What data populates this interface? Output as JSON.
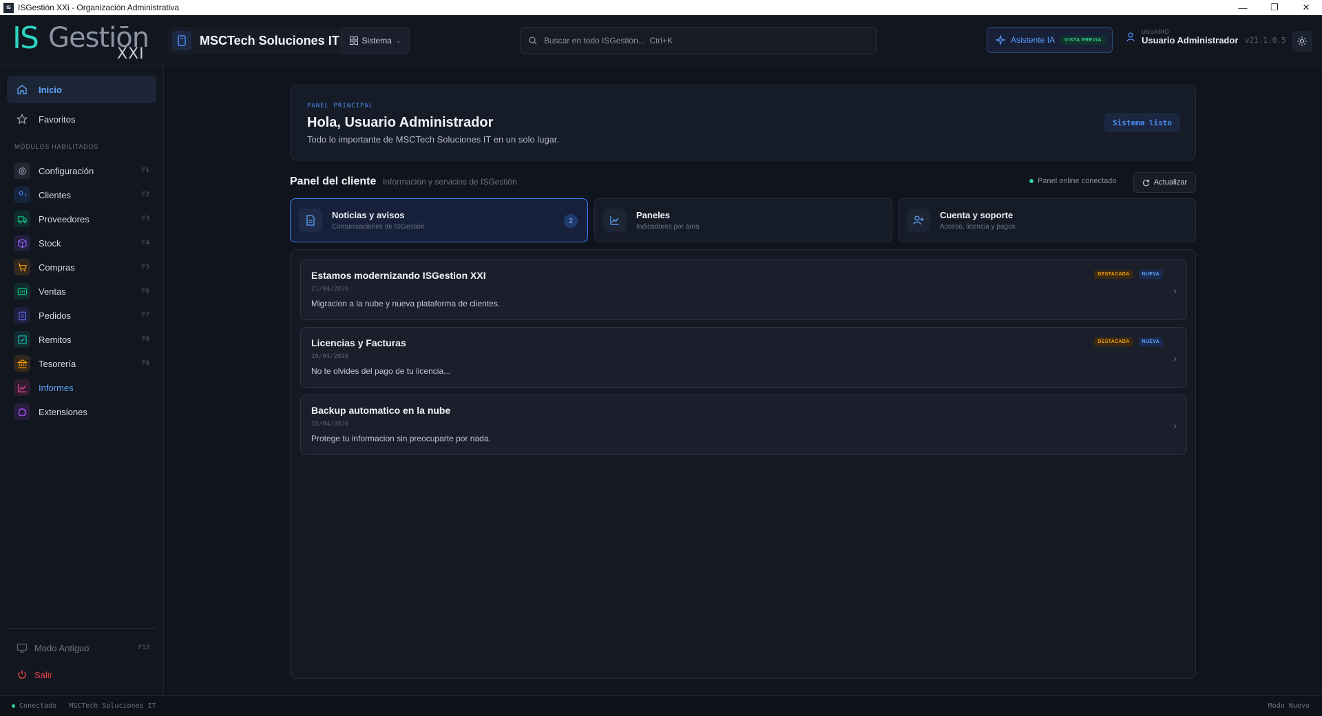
{
  "window": {
    "icon_text": "IS",
    "title": "ISGestión XXi - Organización Administrativa",
    "buttons": [
      "—",
      "❐",
      "✕"
    ]
  },
  "header": {
    "logo": {
      "is": "IS",
      "gestion": "Gestiōn",
      "xxi": "XXI"
    },
    "company_name": "MSCTech Soluciones IT",
    "system_button": "Sistema",
    "search_placeholder": "Buscar en todo ISGestión...  Ctrl+K",
    "ai_label": "Asistente IA",
    "ai_badge": "VISTA PREVIA",
    "user_caption": "USUARIO",
    "user_name": "Usuario Administrador",
    "version": "v21.1.0.5"
  },
  "sidebar": {
    "top_items": [
      {
        "label": "Inicio",
        "icon": "home-icon"
      },
      {
        "label": "Favoritos",
        "icon": "star-icon"
      }
    ],
    "section_title": "MÓDULOS HABILITADOS",
    "modules": [
      {
        "label": "Configuración",
        "key": "F1",
        "icon": "settings-icon",
        "color": "#8b93a3"
      },
      {
        "label": "Clientes",
        "key": "F2",
        "icon": "users-icon",
        "color": "#3b82f6"
      },
      {
        "label": "Proveedores",
        "key": "F3",
        "icon": "truck-icon",
        "color": "#10b981"
      },
      {
        "label": "Stock",
        "key": "F4",
        "icon": "box-icon",
        "color": "#8b5cf6"
      },
      {
        "label": "Compras",
        "key": "F5",
        "icon": "cart-icon",
        "color": "#f59e0b"
      },
      {
        "label": "Ventas",
        "key": "F6",
        "icon": "cash-icon",
        "color": "#10b981"
      },
      {
        "label": "Pedidos",
        "key": "F7",
        "icon": "clipboard-icon",
        "color": "#6366f1"
      },
      {
        "label": "Remitos",
        "key": "F8",
        "icon": "check-square-icon",
        "color": "#14b8a6"
      },
      {
        "label": "Tesorería",
        "key": "F9",
        "icon": "bank-icon",
        "color": "#f59e0b"
      },
      {
        "label": "Informes",
        "key": "",
        "icon": "chart-icon",
        "color": "#ec4899"
      },
      {
        "label": "Extensiones",
        "key": "",
        "icon": "puzzle-icon",
        "color": "#a855f7"
      }
    ],
    "legacy_mode": {
      "label": "Modo Antiguo",
      "key": "F12"
    },
    "logout": "Salir"
  },
  "hero": {
    "caption": "PANEL PRINCIPAL",
    "greeting": "Hola, Usuario Administrador",
    "subtitle": "Todo lo importante de MSCTech Soluciones IT en un solo lugar.",
    "badge": "Sistema listo"
  },
  "panel": {
    "title": "Panel del cliente",
    "subtitle": "Información y servicios de ISGestión",
    "online_status": "Panel online conectado",
    "refresh": "Actualizar",
    "tabs": [
      {
        "title": "Noticias y avisos",
        "subtitle": "Comunicaciones de ISGestión",
        "count": "2"
      },
      {
        "title": "Paneles",
        "subtitle": "Indicadores por área"
      },
      {
        "title": "Cuenta y soporte",
        "subtitle": "Acceso, licencia y pagos"
      }
    ],
    "news": [
      {
        "title": "Estamos modernizando ISGestion XXI",
        "date": "21/04/2026",
        "text": "Migracion a la nube y nueva plataforma de clientes.",
        "tag1": "DESTACADA",
        "tag2": "NUEVA"
      },
      {
        "title": "Licencias y Facturas",
        "date": "19/04/2026",
        "text": "No te olvides del pago de tu licencia...",
        "tag1": "DESTACADA",
        "tag2": "NUEVA"
      },
      {
        "title": "Backup automatico en la nube",
        "date": "15/04/2026",
        "text": "Protege tu informacion sin preocuparte por nada."
      }
    ]
  },
  "statusbar": {
    "connection": "Conectado",
    "company": "MSCTech Soluciones IT",
    "mode": "Modo Nuevo"
  },
  "colors": {
    "accent": "#3b82f6",
    "teal": "#2dd4bf",
    "danger": "#ef4444",
    "background": "#10141d"
  }
}
